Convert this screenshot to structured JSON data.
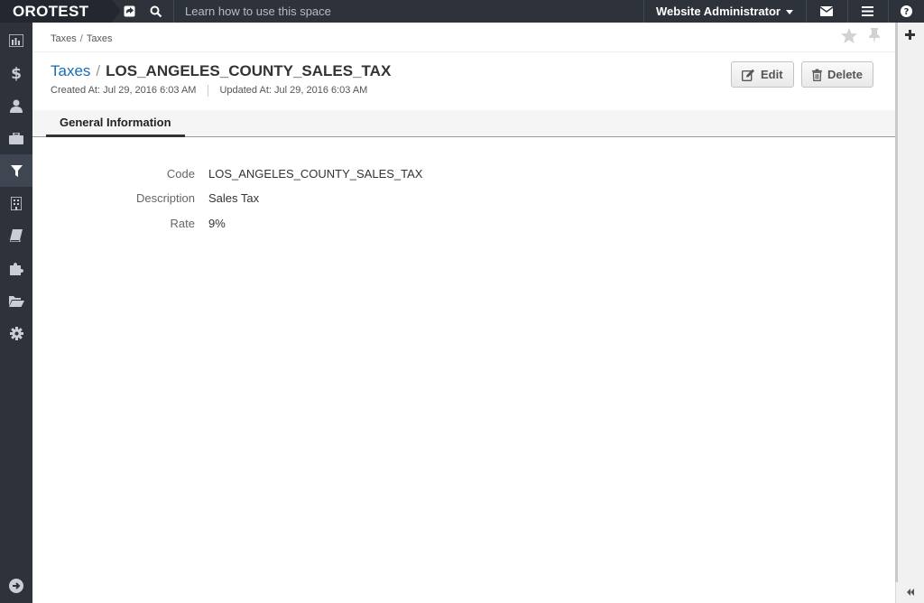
{
  "topbar": {
    "brand": "OROTEST",
    "search_hint": "Learn how to use this space",
    "user_name": "Website Administrator",
    "icons": [
      "shortcut-icon",
      "search-icon",
      "email-icon",
      "menu-icon",
      "help-icon"
    ]
  },
  "sidebar": {
    "items": [
      {
        "name": "dashboard-icon",
        "active": false
      },
      {
        "name": "dollar-icon",
        "active": false
      },
      {
        "name": "user-icon",
        "active": false
      },
      {
        "name": "briefcase-icon",
        "active": false
      },
      {
        "name": "filter-icon",
        "active": true
      },
      {
        "name": "building-icon",
        "active": false
      },
      {
        "name": "book-icon",
        "active": false
      },
      {
        "name": "puzzle-icon",
        "active": false
      },
      {
        "name": "folder-open-icon",
        "active": false
      },
      {
        "name": "gear-icon",
        "active": false
      }
    ],
    "bottom_icon": "arrow-circle-right-icon"
  },
  "breadcrumb": {
    "items": [
      "Taxes",
      "Taxes"
    ],
    "separator": "/"
  },
  "page": {
    "crumb": "Taxes",
    "slash": "/",
    "title": "LOS_ANGELES_COUNTY_SALES_TAX",
    "created": "Created At: Jul 29, 2016 6:03 AM",
    "updated": "Updated At: Jul 29, 2016 6:03 AM"
  },
  "actions": {
    "edit_label": "Edit",
    "delete_label": "Delete"
  },
  "tabs": [
    {
      "label": "General Information",
      "active": true
    }
  ],
  "fields": [
    {
      "label": "Code",
      "value": "LOS_ANGELES_COUNTY_SALES_TAX"
    },
    {
      "label": "Description",
      "value": "Sales Tax"
    },
    {
      "label": "Rate",
      "value": "9%"
    }
  ],
  "colors": {
    "topbar_bg": "#2d323b",
    "link": "#1a6bb5",
    "sidebar_active": "#3f4652"
  }
}
